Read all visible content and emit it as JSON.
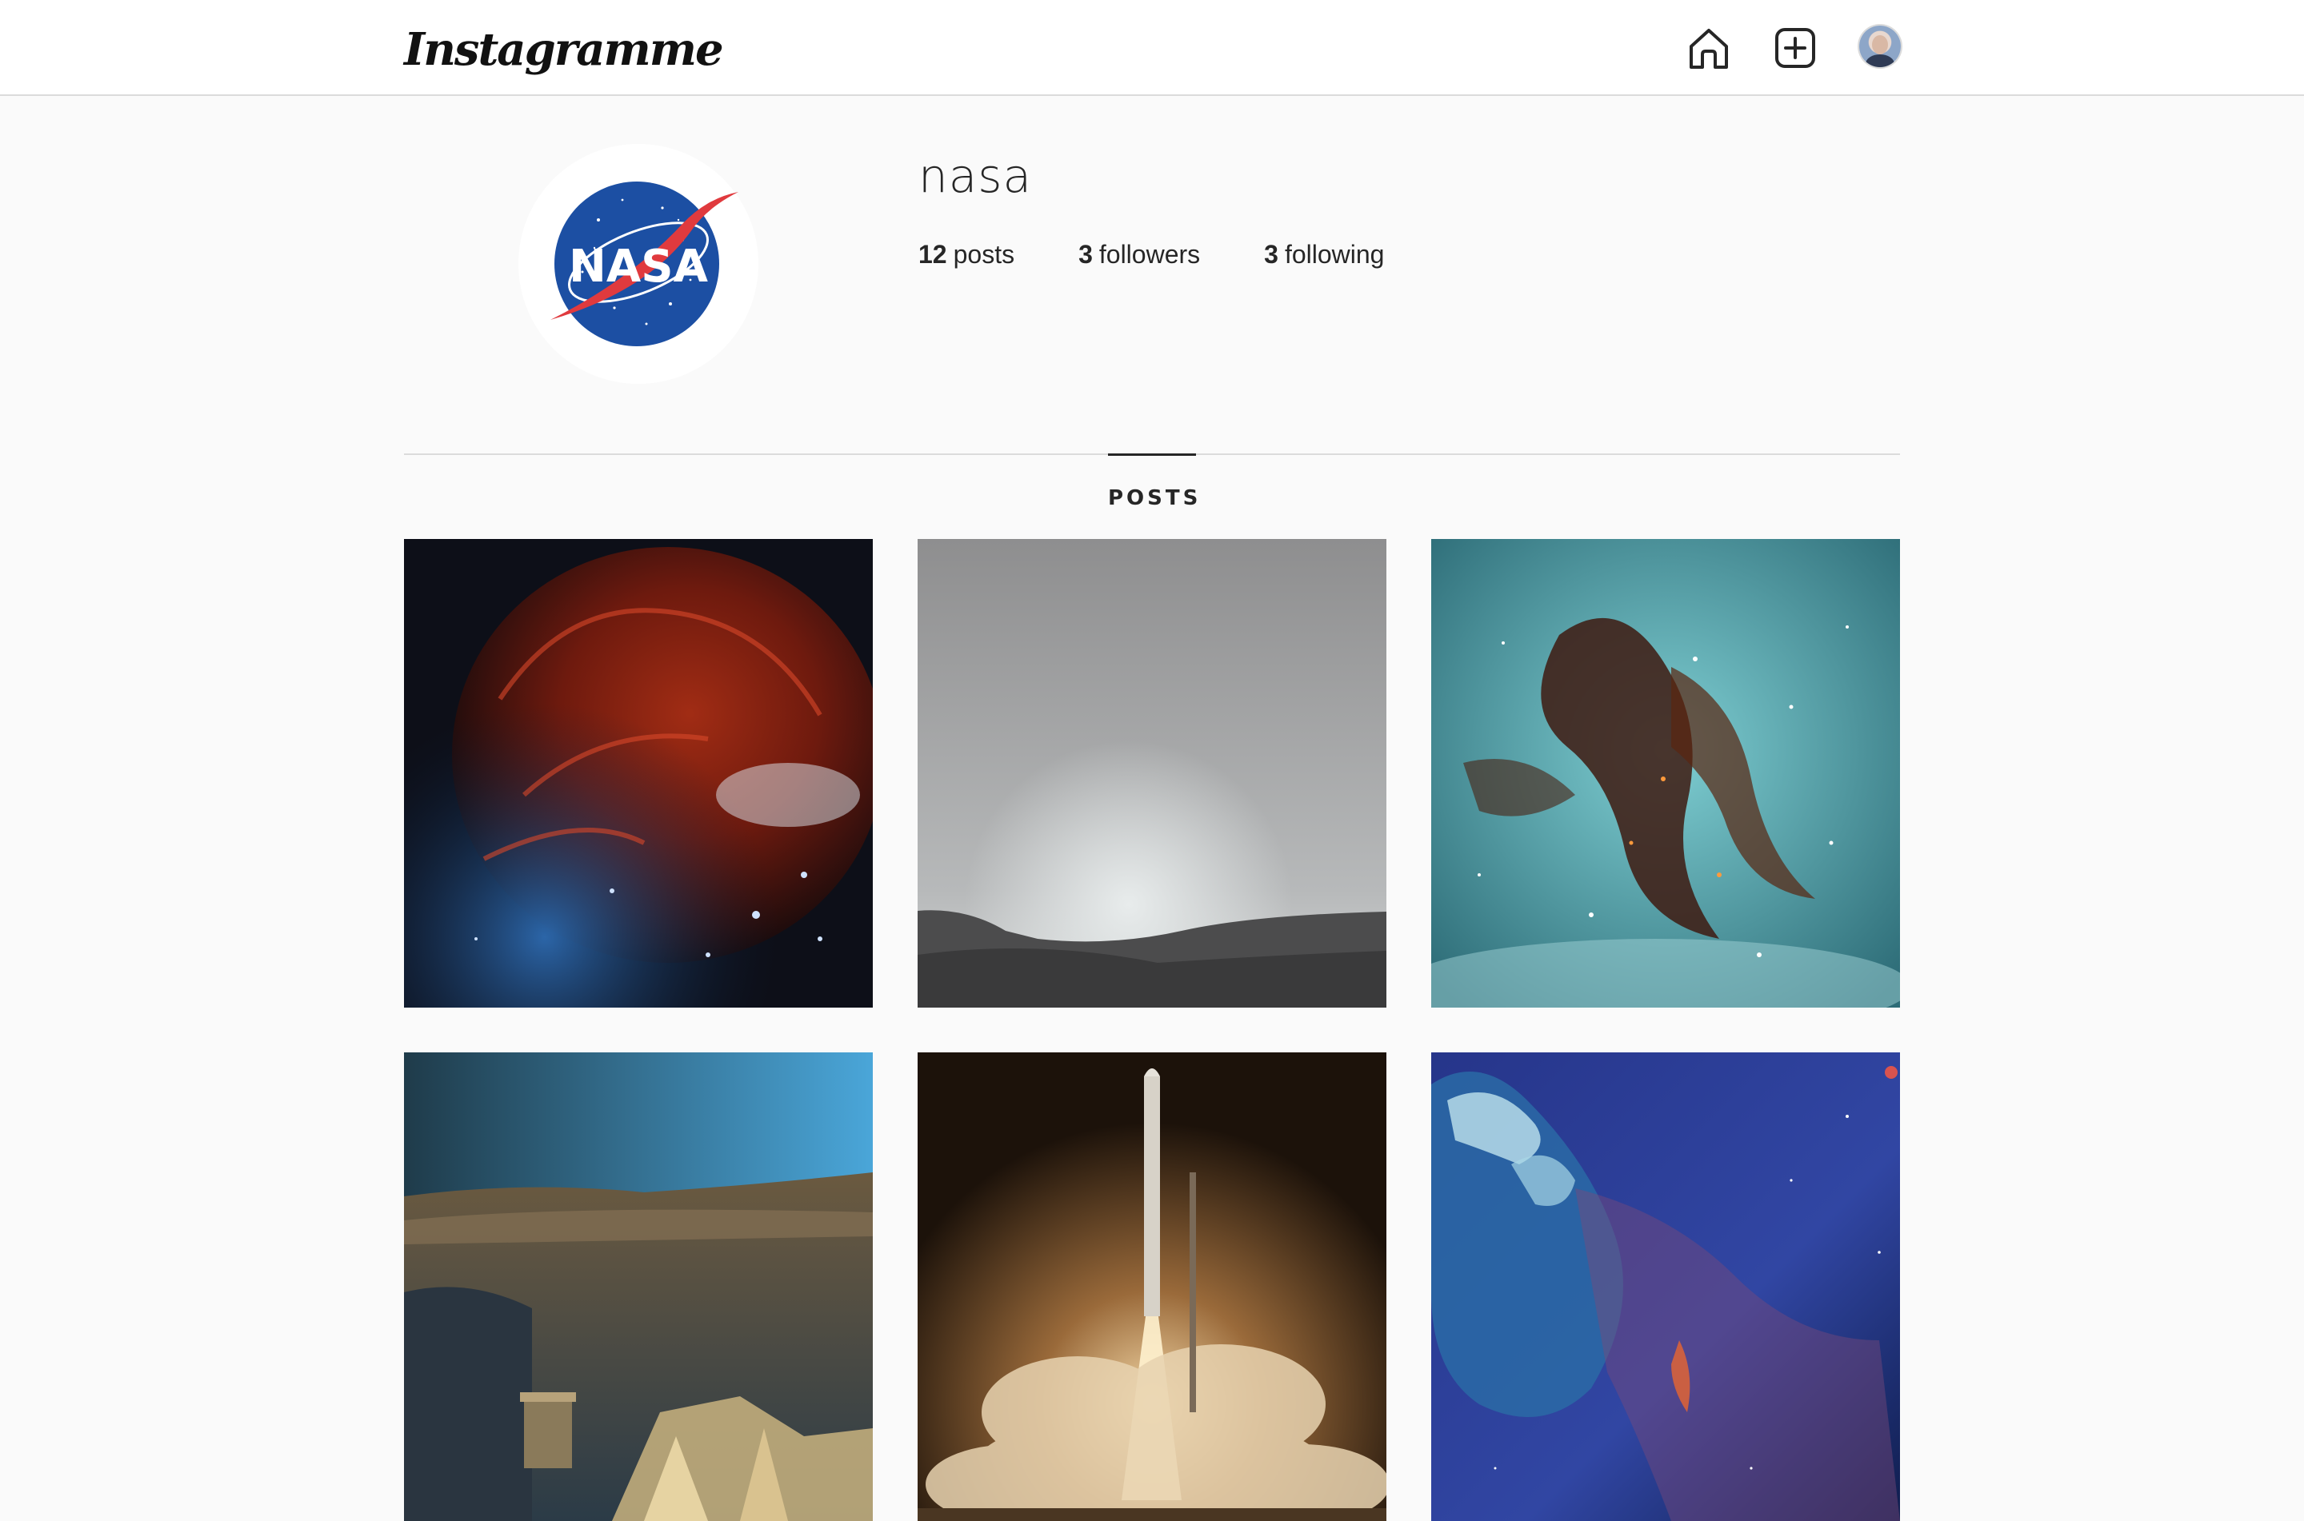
{
  "app": {
    "logo_text": "Instagramme"
  },
  "nav": {
    "home_icon": "home-icon",
    "add_icon": "plus-square-icon",
    "avatar": "user-avatar"
  },
  "profile": {
    "username": "nasa",
    "stats": {
      "posts_count": "12",
      "posts_label": "posts",
      "followers_count": "3",
      "followers_label": "followers",
      "following_count": "3",
      "following_label": "following"
    },
    "avatar_logo_text": "NASA"
  },
  "tabs": {
    "posts_label": "POSTS"
  },
  "posts": [
    {
      "subject": "red-blue-nebula"
    },
    {
      "subject": "mars-sunset-gray"
    },
    {
      "subject": "teal-brown-nebula"
    },
    {
      "subject": "mars-rover-landscape"
    },
    {
      "subject": "rocket-launch"
    },
    {
      "subject": "blue-nebula-cloud"
    }
  ],
  "colors": {
    "background": "#fafafa",
    "topbar": "#ffffff",
    "border": "#dbdbdb",
    "text": "#262626",
    "nasa_blue": "#1c4fa3",
    "nasa_red": "#e03a3e"
  }
}
